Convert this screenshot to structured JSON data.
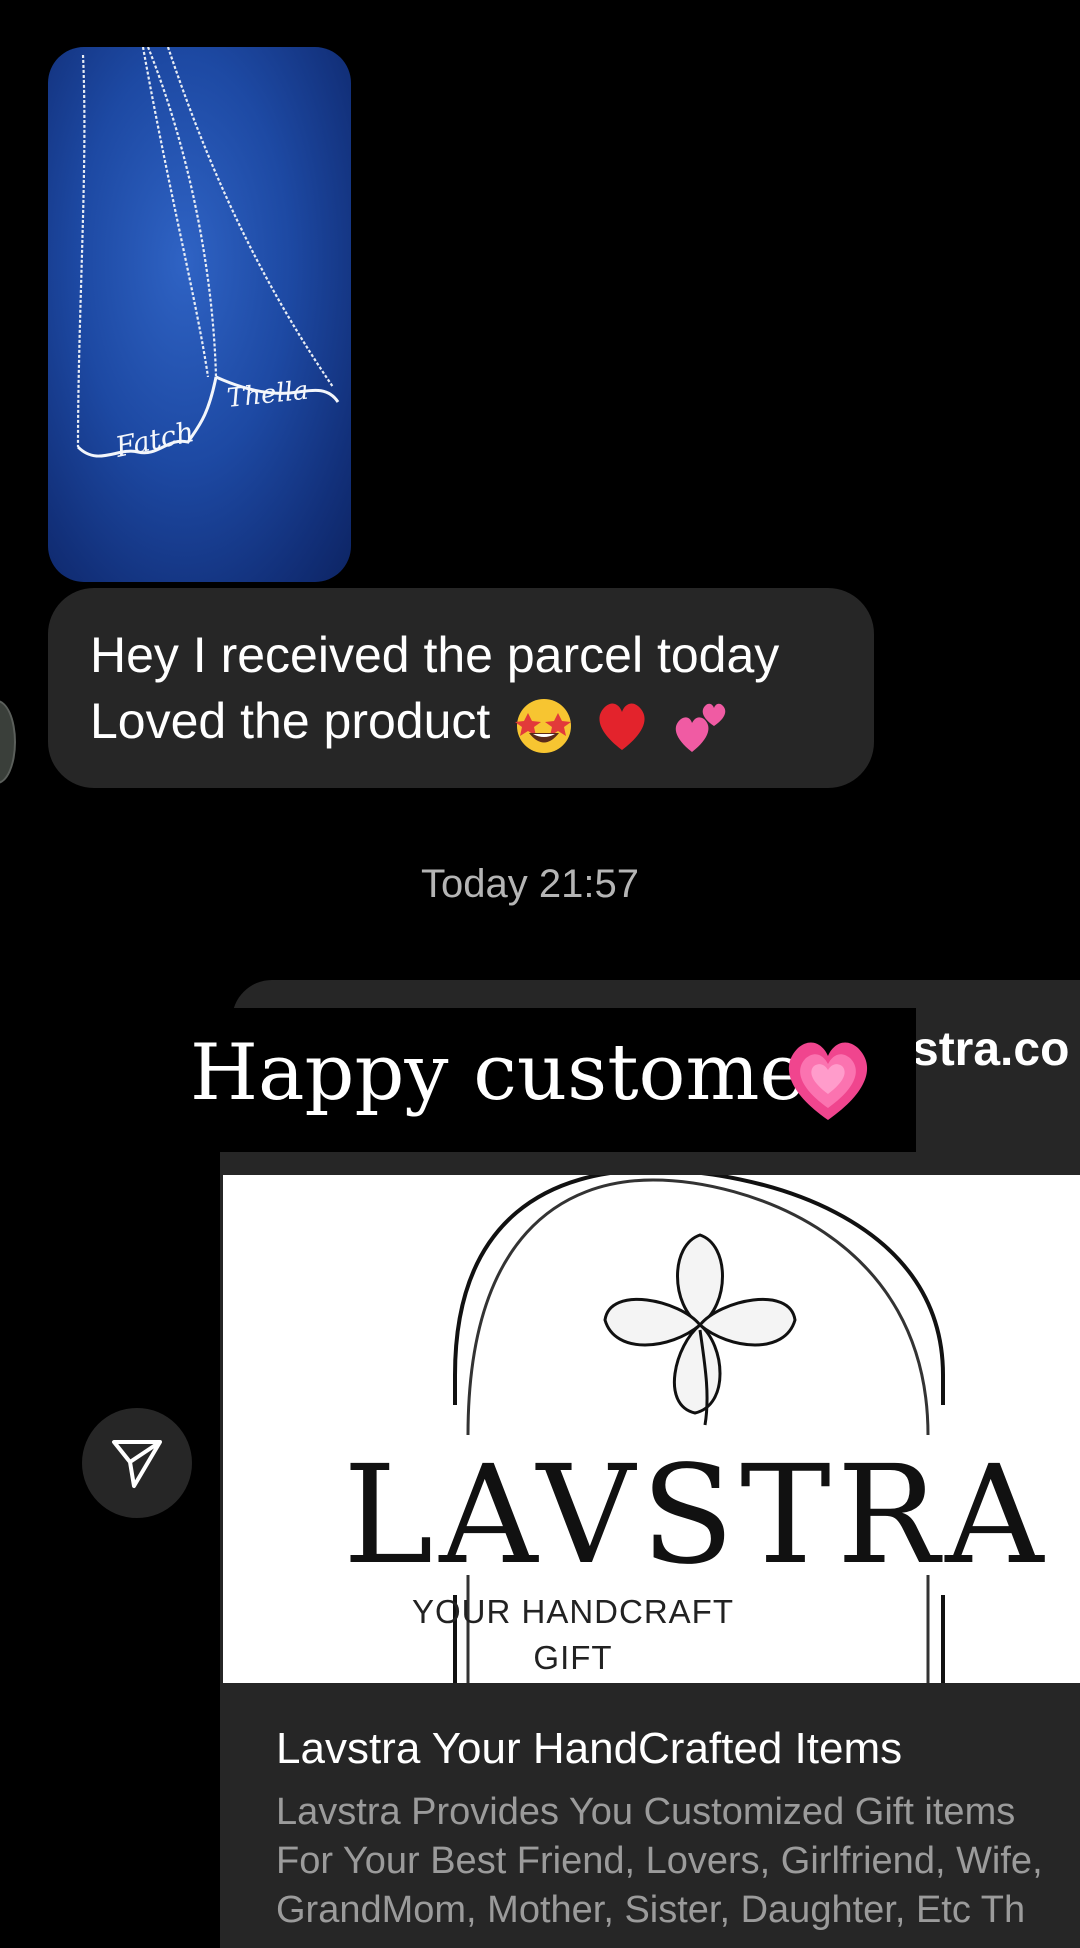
{
  "message": {
    "line1": "Hey I received the parcel today",
    "line2": "Loved the product",
    "emojis": [
      "star-struck-emoji",
      "red-heart-emoji",
      "two-hearts-emoji"
    ]
  },
  "timestamp": "Today 21:57",
  "sticker": {
    "text": "Happy customer",
    "emoji": "beating-heart-emoji"
  },
  "shared_link": {
    "domain_partial": "stra.co",
    "image": {
      "brand": "LAVSTRA",
      "tagline_line1": "YOUR HANDCRAFT",
      "tagline_line2": "GIFT"
    },
    "title": "Lavstra Your HandCrafted Items",
    "description": "Lavstra Provides You Customized Gift items\nFor Your Best Friend, Lovers, Girlfriend, Wife,\nGrandMom, Mother, Sister, Daughter, Etc Th"
  },
  "icons": {
    "send": "send-icon"
  },
  "colors": {
    "background": "#000000",
    "bubble": "#262626",
    "muted_text": "#b5b5b5",
    "photo_blue": "#1d49a3"
  }
}
